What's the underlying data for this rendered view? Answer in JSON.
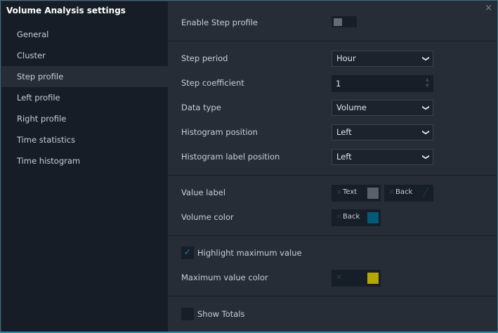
{
  "title": "Volume Analysis settings",
  "nav": [
    "General",
    "Cluster",
    "Step profile",
    "Left profile",
    "Right profile",
    "Time statistics",
    "Time histogram"
  ],
  "selected_nav": "Step profile",
  "close_icon": "×",
  "enable_label": "Enable Step profile",
  "enable_on": false,
  "step_period": {
    "label": "Step period",
    "value": "Hour"
  },
  "step_coefficient": {
    "label": "Step coefficient",
    "value": "1"
  },
  "data_type": {
    "label": "Data type",
    "value": "Volume"
  },
  "histogram_position": {
    "label": "Histogram position",
    "value": "Left"
  },
  "histogram_label_position": {
    "label": "Histogram label position",
    "value": "Left"
  },
  "value_label": {
    "label": "Value label",
    "text": "Text",
    "text_color": "#5b6169",
    "back": "Back"
  },
  "volume_color": {
    "label": "Volume color",
    "back": "Back",
    "color": "#005a78"
  },
  "highlight": {
    "label": "Highlight maximum value",
    "checked": true
  },
  "max_color": {
    "label": "Maximum value color",
    "color": "#b5a600"
  },
  "show_totals": {
    "label": "Show Totals",
    "checked": false
  }
}
